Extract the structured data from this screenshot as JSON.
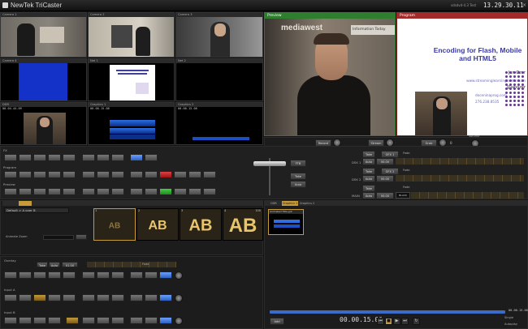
{
  "window": {
    "title": "NewTek TriCaster",
    "session": "sdsdvd-4.3",
    "user": "Test",
    "clock": "13.29.30.11"
  },
  "monitors": {
    "cam1": "Camera 1",
    "cam2": "Camera 2",
    "cam3": "Camera 3",
    "cam4": "Camera 4",
    "net1": "Net 1",
    "net2": "Net 2",
    "ddr": "DDR",
    "ddr_tc": "00.04.44.09",
    "gfx1": "Graphics 1",
    "gfx1_tc": "00.00.15.00",
    "gfx2": "Graphics 2",
    "gfx2_tc": "00.00.15.00",
    "preview": "Preview",
    "program": "Program"
  },
  "slide": {
    "title": "Encoding for Flash, Mobile and HTML5",
    "name": "Jan Ozer",
    "site": "www.streaminglearningcenter.com",
    "twitter": "@janozer",
    "email": "doceninaprog.com",
    "phone": "276.238.8535"
  },
  "background_banner": {
    "left": "mediawest",
    "right": "Information Today"
  },
  "record": {
    "record_label": "Record",
    "stream_label": "Stream",
    "grab_label": "Grab",
    "grab_count": "0",
    "volume_label": "Volume"
  },
  "switcher": {
    "rows": [
      "FX",
      "Program",
      "Preview"
    ],
    "tbar_labels": [
      "FTB",
      "Take",
      "Auto"
    ],
    "dsk_rows": [
      {
        "label": "DSK 1",
        "take": "Take",
        "auto": "Auto",
        "dur": "00.00",
        "gfx": "GFX 1",
        "fade": "Fade"
      },
      {
        "label": "DSK 2",
        "take": "Take",
        "auto": "Auto",
        "dur": "00.00",
        "gfx": "GFX 2",
        "fade": "Fade"
      },
      {
        "label": "MAIN",
        "take": "Take",
        "auto": "Auto",
        "dur": "00.00",
        "black": "BLACK",
        "fade": "Fade"
      }
    ]
  },
  "transitions": {
    "selector": "Default > A over B",
    "animate_zoom": "Animate Zoom",
    "thumb_numbers": [
      "1",
      "2",
      "3",
      "4"
    ],
    "durations": [
      "",
      "",
      "",
      "100"
    ]
  },
  "overlay": {
    "label": "Overlay",
    "take": "Take",
    "auto": "Auto",
    "dur": "01.00",
    "fade": "Fade",
    "inputs": [
      "Input A",
      "Input B"
    ]
  },
  "ddr_panel": {
    "tabs": [
      "DDR",
      "Graphics 1",
      "Graphics 2"
    ],
    "clip_name": "Animated Title.gdr",
    "add_label": "Add",
    "time": "00.00.15.00",
    "duration": "00.00.15.00",
    "single_label": "Single",
    "autoplay_label": "Autoplay"
  }
}
